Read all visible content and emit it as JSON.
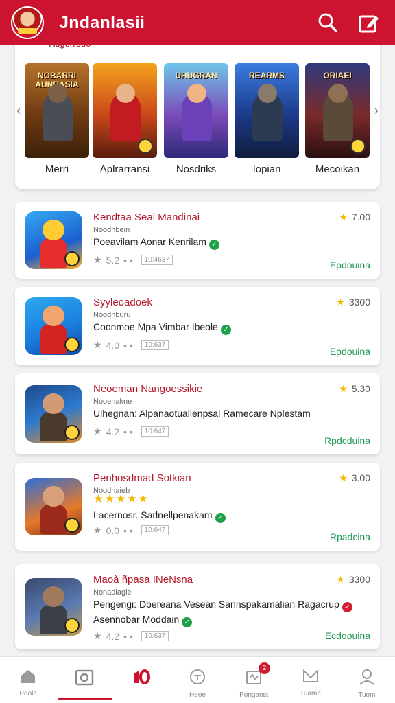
{
  "app": {
    "title": "Jndanlasii"
  },
  "featured": {
    "subtitle": "Augerrouo",
    "games": [
      {
        "label": "Merri",
        "banner": "NOBARRI AUNRASIA",
        "bg": "linear-gradient(180deg,#b3732a 0%,#6e3a12 55%,#3b2208 100%)",
        "body": "#4a4d55",
        "head": "#7b6048"
      },
      {
        "label": "Aplrarransi",
        "banner": "",
        "bg": "linear-gradient(180deg,#f3a11d 0%,#c9481a 55%,#5a1d0c 100%)",
        "body": "#c21b22",
        "head": "#e9b48a"
      },
      {
        "label": "Nosdriks",
        "banner": "UHUGRAN",
        "bg": "linear-gradient(180deg,#6ec6ea 0%,#7b4ab8 55%,#2d2a7a 100%)",
        "body": "#6b41b9",
        "head": "#efb384"
      },
      {
        "label": "Iopian",
        "banner": "REARMS",
        "bg": "linear-gradient(180deg,#3b7de0 0%,#1c3a8a 55%,#101d3d 100%)",
        "body": "#2d3b52",
        "head": "#8a7a6a"
      },
      {
        "label": "Mecoikan",
        "banner": "ORIAEI",
        "bg": "linear-gradient(180deg,#2f3a7e 0%,#7a2a2a 55%,#2a1010 100%)",
        "body": "#5b4a3a",
        "head": "#8f6f55"
      }
    ]
  },
  "games": [
    {
      "title": "Kendtaa Seai Mandinai",
      "developer": "Noodnbein",
      "description": "Poeavilam Aonar Kenrilam",
      "check": "green",
      "stars": "",
      "meta_rating": "5.2",
      "meta_tag": "10:4637",
      "rating": "7.00",
      "action": "Epdouina",
      "icon_bg": "linear-gradient(160deg,#36a8f0 0%,#1b5fd0 60%,#ffb020 100%)",
      "icon_body": "#e62d2d",
      "icon_head": "#ffcc33"
    },
    {
      "title": "Syyleoadoek",
      "developer": "Noodnburu",
      "description": "Coonmoe Mpa Vimbar Ibeole",
      "check": "green",
      "stars": "",
      "meta_rating": "4.0",
      "meta_tag": "10:637",
      "rating": "3300",
      "action": "Epdouina",
      "icon_bg": "linear-gradient(160deg,#2ea8ee 0%,#1a7fe0 55%,#0f4aa8 100%)",
      "icon_body": "#d42323",
      "icon_head": "#f2a66e"
    },
    {
      "title": "Neoeman Nangoessikie",
      "developer": "Nooenakne",
      "description": "Ulhegnan: Alpanaotualienpsal Ramecare Nplestam",
      "check": "",
      "stars": "",
      "meta_rating": "4.2",
      "meta_tag": "10:647",
      "rating": "5.30",
      "action": "Rpdcduina",
      "icon_bg": "linear-gradient(160deg,#1f4a8a 0%,#2c7ad0 50%,#e08a2a 100%)",
      "icon_body": "#4a3a2c",
      "icon_head": "#d39a76"
    },
    {
      "title": "Penhosdmad Sotkian",
      "developer": "Noodhaieb",
      "description": "Lacernosr. Sarlnellpenakam",
      "check": "green",
      "stars": "★★★★★",
      "meta_rating": "0.0",
      "meta_tag": "10:647",
      "rating": "3.00",
      "action": "Rpadcina",
      "icon_bg": "linear-gradient(160deg,#2c6fd6 0%,#e6782a 60%,#7a3414 100%)",
      "icon_body": "#9c2a1c",
      "icon_head": "#d8a07a"
    },
    {
      "title": "Maoà ñpasa INeNsna",
      "developer": "Nonadlagie",
      "description": "Pengengi: Dbereana Vesean Sannspakamalian Ragacrup",
      "check": "red",
      "stars": "",
      "subline": "Asennobar Moddain",
      "meta_rating": "4.2",
      "meta_tag": "10:637",
      "rating": "3300",
      "action": "Ecdoouina",
      "icon_bg": "linear-gradient(160deg,#3a4a6e 0%,#5a7ab0 55%,#c09a50 100%)",
      "icon_body": "#3a3f48",
      "icon_head": "#a07a5a"
    }
  ],
  "nav": {
    "items": [
      {
        "label": "Pdole",
        "icon": "home-icon"
      },
      {
        "label": "",
        "icon": "camera-icon"
      },
      {
        "label": "",
        "icon": "featured-icon"
      },
      {
        "label": "Heoe",
        "icon": "compass-icon"
      },
      {
        "label": "Ponganst",
        "icon": "bag-icon",
        "badge": "2"
      },
      {
        "label": "Tuame",
        "icon": "mail-icon"
      },
      {
        "label": "Tuom",
        "icon": "profile-icon"
      }
    ]
  },
  "colors": {
    "accent": "#cc1430",
    "action": "#1d9a54",
    "star": "#f5b800"
  }
}
